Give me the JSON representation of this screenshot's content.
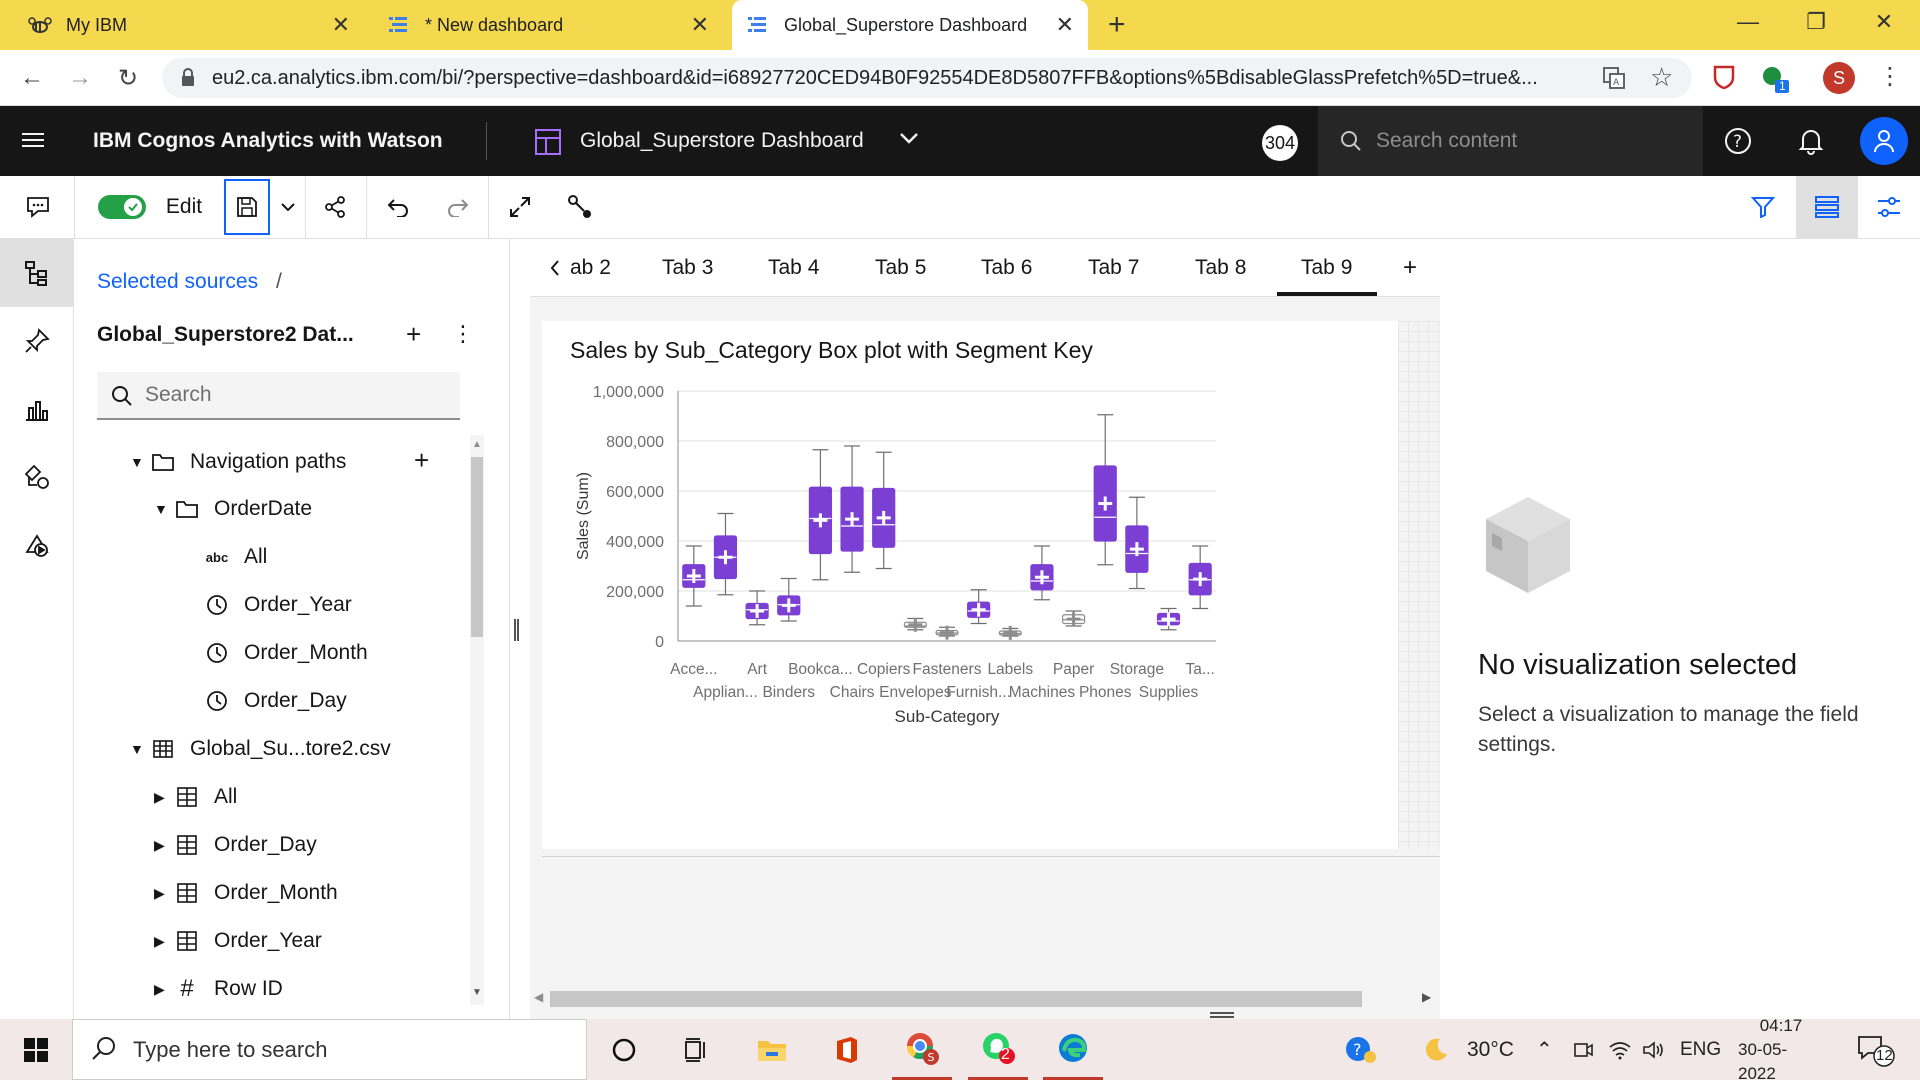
{
  "browser": {
    "tabs": [
      {
        "label": "My IBM"
      },
      {
        "label": "* New dashboard"
      },
      {
        "label": "Global_Superstore Dashboard"
      }
    ],
    "url": "eu2.ca.analytics.ibm.com/bi/?perspective=dashboard&id=i68927720CED94B0F92554DE8D5807FFB&options%5BdisableGlassPrefetch%5D=true&...",
    "extension_badge": "1",
    "profile_initial": "S"
  },
  "header": {
    "brand": "IBM Cognos Analytics with Watson",
    "dashboard_name": "Global_Superstore Dashboard",
    "notification_count": "304",
    "search_placeholder": "Search content"
  },
  "toolbar": {
    "edit_label": "Edit"
  },
  "datapanel": {
    "breadcrumb": "Selected sources",
    "breadcrumb_sep": "/",
    "source_name": "Global_Superstore2 Dat...",
    "search_placeholder": "Search",
    "tree": [
      {
        "label": "Navigation paths"
      },
      {
        "label": "OrderDate"
      },
      {
        "label": "All",
        "icon_text": "abc"
      },
      {
        "label": "Order_Year"
      },
      {
        "label": "Order_Month"
      },
      {
        "label": "Order_Day"
      },
      {
        "label": "Global_Su...tore2.csv"
      },
      {
        "label": "All"
      },
      {
        "label": "Order_Day"
      },
      {
        "label": "Order_Month"
      },
      {
        "label": "Order_Year"
      },
      {
        "label": "Row ID",
        "icon_text": "#"
      }
    ]
  },
  "dashtabs": [
    "ab 2",
    "Tab 3",
    "Tab 4",
    "Tab 5",
    "Tab 6",
    "Tab 7",
    "Tab 8",
    "Tab 9"
  ],
  "chart_data": {
    "type": "boxplot",
    "title": "Sales by Sub_Category Box plot with Segment Key",
    "xlabel": "Sub-Category",
    "ylabel": "Sales (Sum)",
    "ylim": [
      0,
      1000000
    ],
    "y_ticks": [
      "0",
      "200,000",
      "400,000",
      "600,000",
      "800,000",
      "1,000,000"
    ],
    "box_color": "#7b3fd4",
    "categories": [
      {
        "top": "Acce...",
        "bottom": "",
        "min": 140000,
        "q1": 215000,
        "median": 245000,
        "q3": 305000,
        "max": 380000
      },
      {
        "top": "",
        "bottom": "Applian...",
        "min": 185000,
        "q1": 250000,
        "median": 335000,
        "q3": 420000,
        "max": 510000
      },
      {
        "top": "Art",
        "bottom": "",
        "min": 65000,
        "q1": 90000,
        "median": 125000,
        "q3": 150000,
        "max": 200000
      },
      {
        "top": "",
        "bottom": "Binders",
        "min": 80000,
        "q1": 105000,
        "median": 145000,
        "q3": 180000,
        "max": 250000
      },
      {
        "top": "Bookca...",
        "bottom": "",
        "min": 245000,
        "q1": 350000,
        "median": 490000,
        "q3": 615000,
        "max": 765000
      },
      {
        "top": "",
        "bottom": "Chairs",
        "min": 275000,
        "q1": 360000,
        "median": 460000,
        "q3": 615000,
        "max": 780000
      },
      {
        "top": "Copiers",
        "bottom": "",
        "min": 290000,
        "q1": 375000,
        "median": 465000,
        "q3": 610000,
        "max": 755000
      },
      {
        "top": "",
        "bottom": "Envelopes",
        "min": 45000,
        "q1": 55000,
        "median": 60000,
        "q3": 75000,
        "max": 90000
      },
      {
        "top": "Fasteners",
        "bottom": "",
        "min": 20000,
        "q1": 25000,
        "median": 32000,
        "q3": 42000,
        "max": 55000
      },
      {
        "top": "",
        "bottom": "Furnish...",
        "min": 70000,
        "q1": 95000,
        "median": 120000,
        "q3": 155000,
        "max": 205000
      },
      {
        "top": "Labels",
        "bottom": "",
        "min": 20000,
        "q1": 25000,
        "median": 30000,
        "q3": 40000,
        "max": 50000
      },
      {
        "top": "",
        "bottom": "Machines",
        "min": 165000,
        "q1": 205000,
        "median": 240000,
        "q3": 305000,
        "max": 380000
      },
      {
        "top": "Paper",
        "bottom": "",
        "min": 60000,
        "q1": 70000,
        "median": 85000,
        "q3": 105000,
        "max": 120000
      },
      {
        "top": "",
        "bottom": "Phones",
        "min": 305000,
        "q1": 400000,
        "median": 495000,
        "q3": 700000,
        "max": 905000
      },
      {
        "top": "Storage",
        "bottom": "",
        "min": 210000,
        "q1": 275000,
        "median": 350000,
        "q3": 460000,
        "max": 575000
      },
      {
        "top": "",
        "bottom": "Supplies",
        "min": 45000,
        "q1": 65000,
        "median": 80000,
        "q3": 110000,
        "max": 130000
      },
      {
        "top": "Ta...",
        "bottom": "",
        "min": 130000,
        "q1": 185000,
        "median": 245000,
        "q3": 310000,
        "max": 380000
      }
    ]
  },
  "rightpanel": {
    "title": "No visualization selected",
    "message": "Select a visualization to manage the field settings."
  },
  "taskbar": {
    "search_placeholder": "Type here to search",
    "whatsapp_badge": "2",
    "temperature": "30°C",
    "language": "ENG",
    "time": "04:17",
    "date": "30-05-2022",
    "notif_count": "12"
  }
}
